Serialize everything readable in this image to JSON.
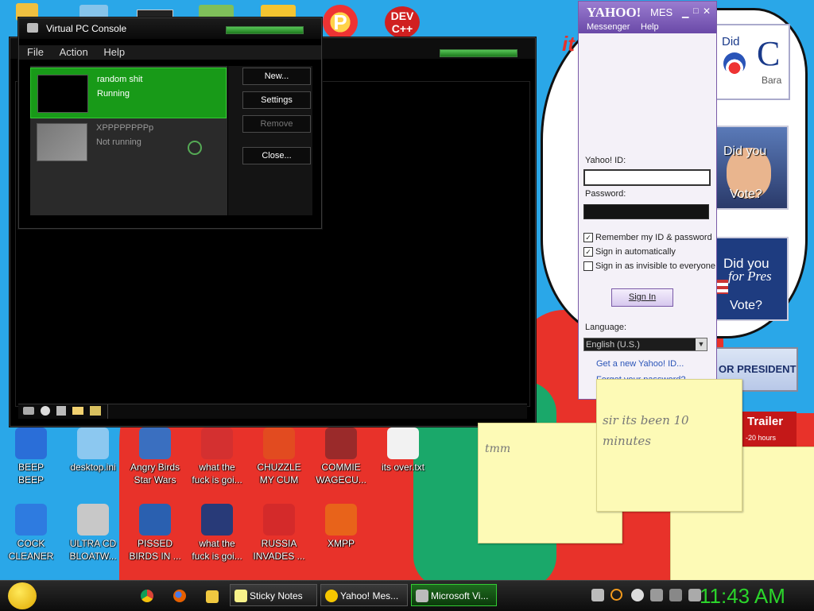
{
  "desktop": {
    "icons": [
      {
        "label": "BEEP\nBEEP",
        "icon": "folder-blue-icon"
      },
      {
        "label": "desktop.ini",
        "icon": "settings-file-icon"
      },
      {
        "label": "Angry Birds\nStar Wars",
        "icon": "angry-birds-star-wars-icon"
      },
      {
        "label": "what the\nfuck is goi...",
        "icon": "angry-bird-icon"
      },
      {
        "label": "CHUZZLE\nMY CUM",
        "icon": "chuzzle-icon"
      },
      {
        "label": "COMMIE\nWAGECU...",
        "icon": "commie-icon"
      },
      {
        "label": "its over.txt",
        "icon": "text-file-icon"
      },
      {
        "label": "COCK\nCLEANER",
        "icon": "recycle-bin-icon"
      },
      {
        "label": "ULTRA CD\nBLOATW...",
        "icon": "cd-icon"
      },
      {
        "label": "PISSED\nBIRDS IN ...",
        "icon": "angry-birds-icon"
      },
      {
        "label": "what the\nfuck is goi...",
        "icon": "angry-birds-space-icon"
      },
      {
        "label": "RUSSIA\nINVADES ...",
        "icon": "radiation-icon"
      },
      {
        "label": "XMPP",
        "icon": "xampp-icon"
      }
    ],
    "top_icons": {
      "dev_label": "DEV\nC++"
    },
    "posters": {
      "poster1_line1": "Did",
      "poster1_line2": "Bara",
      "poster2_line1": "Did you",
      "poster2_line2": "Vote?",
      "poster3_line1": "Did you",
      "poster3_line2": "for Pres",
      "poster3_line3": "Vote?",
      "poster4": "OR PRESIDENT",
      "trailer_title": "Trailer",
      "trailer_sub": "-20 hours",
      "wall_text": "it"
    }
  },
  "vpc_console": {
    "title": "Virtual PC Console",
    "menu": [
      "File",
      "Action",
      "Help"
    ],
    "vms": [
      {
        "name": "random shit",
        "state": "Running"
      },
      {
        "name": "XPPPPPPPPp",
        "state": "Not running"
      }
    ],
    "buttons": {
      "new": "New...",
      "settings": "Settings",
      "remove": "Remove",
      "close": "Close..."
    }
  },
  "yahoo": {
    "brand": "YAHOO!",
    "brand_suffix": "MES",
    "menu": [
      "Messenger",
      "Help"
    ],
    "id_label": "Yahoo! ID:",
    "id_value": "",
    "password_label": "Password:",
    "password_value": "",
    "remember": "Remember my ID & password",
    "sign_in_auto": "Sign in automatically",
    "invisible": "Sign in as invisible to everyone",
    "sign_in_button": "Sign In",
    "language_label": "Language:",
    "language_value": "English (U.S.)",
    "new_id_link": "Get a new Yahoo! ID...",
    "forgot_link": "Forgot your password?",
    "checks": {
      "remember": true,
      "auto": true,
      "invisible": false
    }
  },
  "sticky_notes": [
    {
      "text": "tmm"
    },
    {
      "text": "sir its been 10\nminutes"
    }
  ],
  "taskbar": {
    "buttons": [
      "Sticky Notes",
      "Yahoo! Mes...",
      "Microsoft Vi..."
    ],
    "clock": "11:43 AM"
  },
  "colors": {
    "accent_green": "#1f8f1f",
    "yahoo_purple": "#7b5cb8",
    "clock_green": "#2bd42b"
  }
}
